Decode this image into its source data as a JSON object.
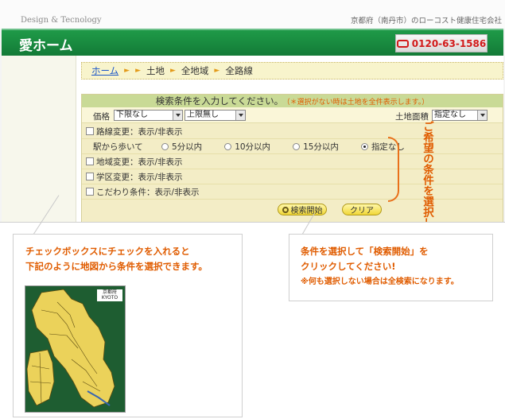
{
  "header": {
    "tagline": "Design & Tecnology",
    "top_info": "京都府（南丹市）のローコスト健康住宅会社",
    "site_name": "愛ホーム",
    "phone": "0120-63-1586",
    "phone_icon": "phone-icon"
  },
  "breadcrumb": [
    "ホーム",
    "土地",
    "全地域",
    "全路線"
  ],
  "search": {
    "heading": "検索条件を入力してください。",
    "heading_note": "（＊選択がない時は土地を全件表示します。）",
    "price_label": "価格",
    "price_min": "下限なし",
    "price_tilde": "〜",
    "price_max": "上限無し",
    "area_label": "土地面積",
    "area_value": "指定なし",
    "route_toggle": "路線変更：表示/非表示",
    "walk_label": "駅から歩いて",
    "walk_options": [
      "5分以内",
      "10分以内",
      "15分以内",
      "指定なし"
    ],
    "walk_selected": "指定なし",
    "region_toggle": "地域変更：表示/非表示",
    "school_toggle": "学区変更：表示/非表示",
    "preference_toggle": "こだわり条件：表示/非表示",
    "search_button": "検索開始",
    "clear_button": "クリア"
  },
  "annotation": {
    "vertical_text": "ご希望の条件を選択してください。",
    "callout_left_line1": "チェックボックスにチェックを入れると",
    "callout_left_line2": "下記のように地図から条件を選択できます。",
    "map_badge_line1": "京都府",
    "map_badge_line2": "KYOTO",
    "callout_right_line1": "条件を選択して「検索開始」を",
    "callout_right_line2": "クリックしてください!",
    "callout_right_note": "※何も選択しない場合は全検索になります。"
  },
  "colors": {
    "green": "#137b37",
    "orange": "#e05c00",
    "panel": "#f3edc6"
  }
}
